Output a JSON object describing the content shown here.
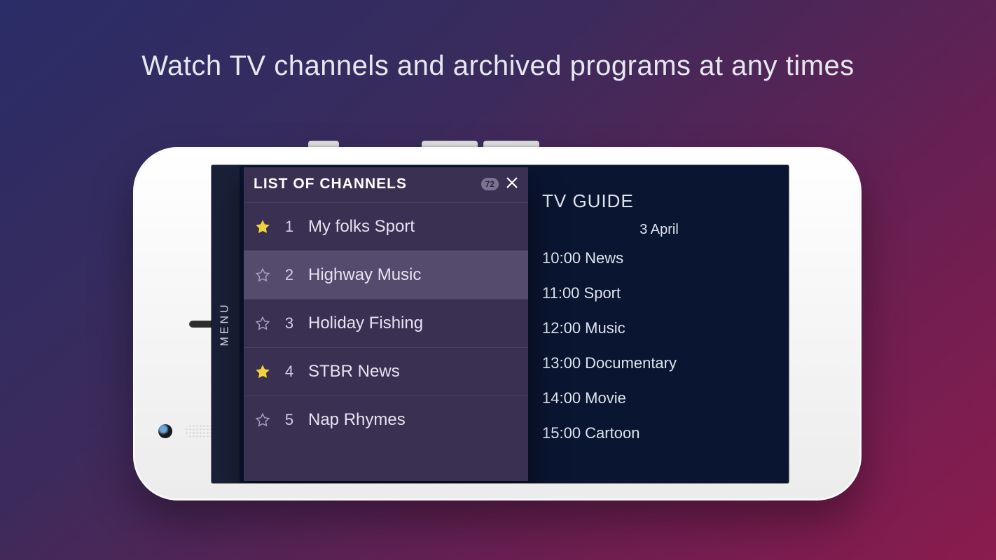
{
  "headline": "Watch TV channels and archived programs at any times",
  "menu_label": "MENU",
  "panel": {
    "title": "LIST OF CHANNELS",
    "count": "72",
    "channels": [
      {
        "num": "1",
        "name": "My folks Sport",
        "fav": true,
        "selected": false
      },
      {
        "num": "2",
        "name": "Highway Music",
        "fav": false,
        "selected": true
      },
      {
        "num": "3",
        "name": "Holiday Fishing",
        "fav": false,
        "selected": false
      },
      {
        "num": "4",
        "name": "STBR News",
        "fav": true,
        "selected": false
      },
      {
        "num": "5",
        "name": "Nap Rhymes",
        "fav": false,
        "selected": false
      }
    ]
  },
  "guide": {
    "title": "TV GUIDE",
    "date": "3 April",
    "rows": [
      "10:00 News",
      "11:00 Sport",
      "12:00 Music",
      "13:00 Documentary",
      "14:00 Movie",
      "15:00 Cartoon"
    ]
  }
}
